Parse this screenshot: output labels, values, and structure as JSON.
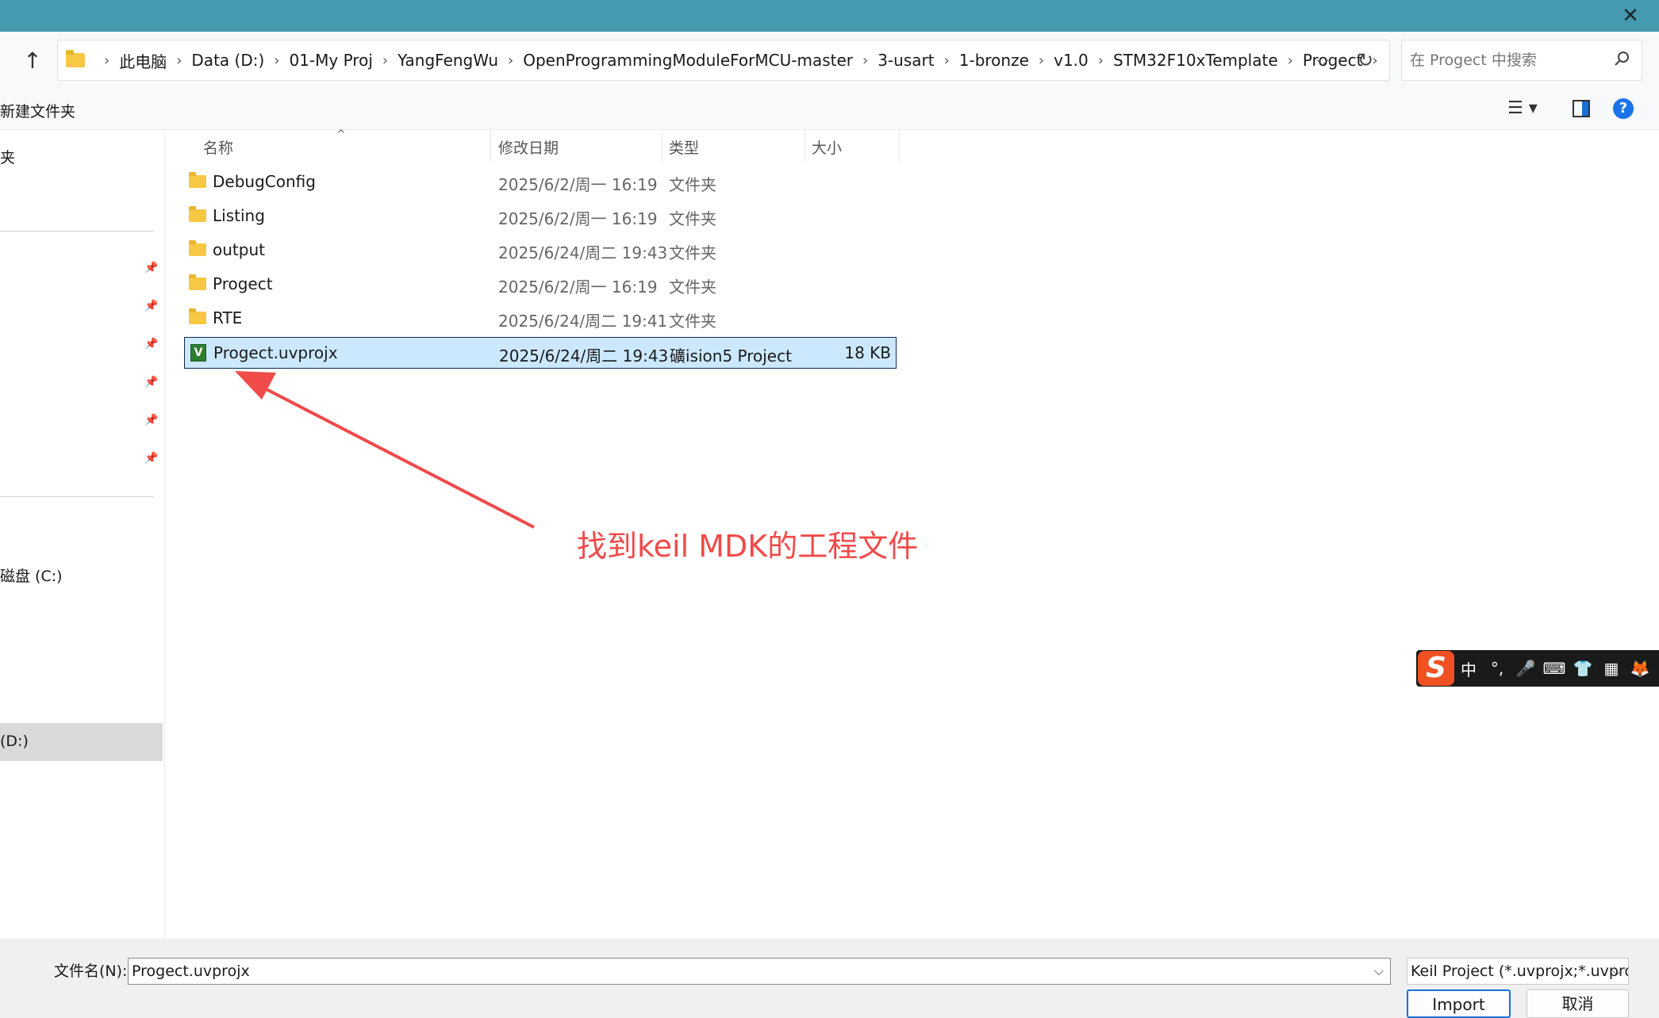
{
  "window": {
    "close_glyph": "✕"
  },
  "nav": {
    "up_glyph": "↑",
    "breadcrumbs": [
      "此电脑",
      "Data (D:)",
      "01-My Proj",
      "YangFengWu",
      "OpenProgrammingModuleForMCU-master",
      "3-usart",
      "1-bronze",
      "v1.0",
      "STM32F10xTemplate",
      "Progect"
    ],
    "separator": "›",
    "dropdown_glyph": "⌵",
    "refresh_glyph": "↻",
    "search_placeholder": "在 Progect 中搜索"
  },
  "commands": {
    "new_folder": "新建文件夹",
    "view_glyph": "☰ ▾",
    "help_glyph": "?"
  },
  "sidebar": {
    "item_top": "夹",
    "drive_c": "磁盘 (C:)",
    "drive_d": "(D:)"
  },
  "columns": {
    "name": "名称",
    "date": "修改日期",
    "type": "类型",
    "size": "大小",
    "sort_glyph": "^"
  },
  "files": [
    {
      "name": "DebugConfig",
      "date": "2025/6/2/周一 16:19",
      "type": "文件夹",
      "size": "",
      "icon": "folder-icon"
    },
    {
      "name": "Listing",
      "date": "2025/6/2/周一 16:19",
      "type": "文件夹",
      "size": "",
      "icon": "folder-icon"
    },
    {
      "name": "output",
      "date": "2025/6/24/周二 19:43",
      "type": "文件夹",
      "size": "",
      "icon": "folder-icon"
    },
    {
      "name": "Progect",
      "date": "2025/6/2/周一 16:19",
      "type": "文件夹",
      "size": "",
      "icon": "folder-icon"
    },
    {
      "name": "RTE",
      "date": "2025/6/24/周二 19:41",
      "type": "文件夹",
      "size": "",
      "icon": "folder-icon"
    },
    {
      "name": "Progect.uvprojx",
      "date": "2025/6/24/周二 19:43",
      "type": "礦ision5 Project",
      "size": "18 KB",
      "icon": "uvision-project-icon",
      "selected": true
    }
  ],
  "annotation": {
    "text": "找到keil MDK的工程文件",
    "color": "#f04a4a"
  },
  "ime": {
    "logo": "S",
    "items": [
      "中",
      "°,",
      "🎤",
      "⌨",
      "👕",
      "▦",
      "🦊"
    ]
  },
  "footer": {
    "filename_label": "文件名(N):",
    "filename_value": "Progect.uvprojx",
    "filter_value": "Keil Project (*.uvprojx;*.uvproj",
    "dropdown_glyph": "⌵",
    "import_label": "Import",
    "cancel_label": "取消"
  },
  "colors": {
    "titlebar": "#459aaf",
    "selection": "#cce8ff",
    "accent": "#1a6fd6"
  }
}
